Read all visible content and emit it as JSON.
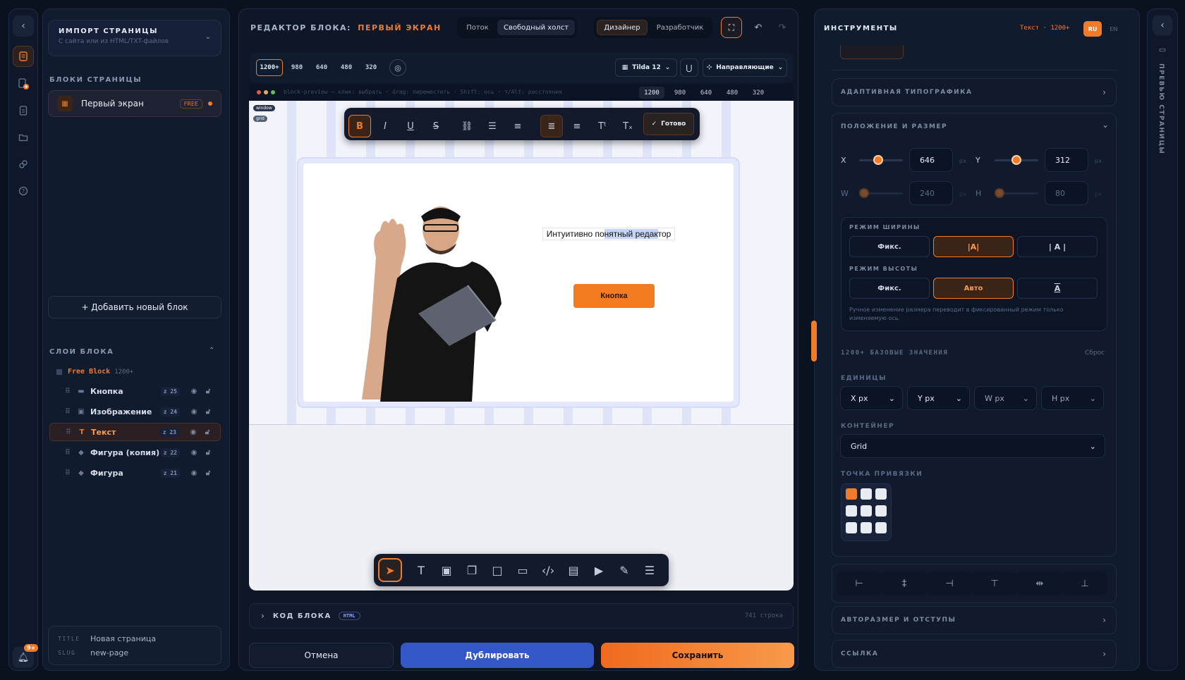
{
  "app": {
    "accent": "#f07b2b",
    "bg": "#0a1220"
  },
  "left": {
    "import_title": "ИМПОРТ СТРАНИЦЫ",
    "import_sub": "С сайта или из HTML/TXT-файлов",
    "blocks_title": "БЛОКИ СТРАНИЦЫ",
    "block_name": "Первый экран",
    "block_badge": "FREE",
    "add_block": "+ Добавить новый блок",
    "layers_title": "СЛОИ БЛОКА",
    "layer_root": "Free Block",
    "layer_root_bp": "1200+",
    "layers": [
      {
        "name": "Кнопка",
        "z": "z 25",
        "icon": "button-icon"
      },
      {
        "name": "Изображение",
        "z": "z 24",
        "icon": "image-icon"
      },
      {
        "name": "Текст",
        "z": "z 23",
        "icon": "text-icon"
      },
      {
        "name": "Фигура (копия)",
        "z": "z 22",
        "icon": "shape-icon"
      },
      {
        "name": "Фигура",
        "z": "z 21",
        "icon": "shape-icon"
      }
    ],
    "page_title_label": "TITLE",
    "page_title": "Новая страница",
    "slug_label": "SLUG",
    "slug": "new-page",
    "notif_count": "9+"
  },
  "editor": {
    "title_prefix": "РЕДАКТОР БЛОКА:",
    "title_block": "ПЕРВЫЙ ЭКРАН",
    "mode_tabs": [
      "Поток",
      "Свободный холст"
    ],
    "role_tabs": [
      "Дизайнер",
      "Разработчик"
    ],
    "breakpoints": [
      "1200+",
      "980",
      "640",
      "480",
      "320"
    ],
    "grid_label": "Tilda 12",
    "guides_label": "Направляющие",
    "preview_hint": "block-preview — клик: выбрать · drag: переместить · Shift: ось · ⌥/Alt: расстояния",
    "preview_bps": [
      "1200",
      "980",
      "640",
      "480",
      "320"
    ],
    "tag_window": "window",
    "tag_grid": "grid",
    "done_label": "Готово",
    "canvas_text_pre": "Интуитивно по",
    "canvas_text_sel": "нятный редак",
    "canvas_text_post": "тор",
    "canvas_button": "Кнопка",
    "code_title": "КОД БЛОКА",
    "code_badge": "HTML",
    "code_lines": "741 строка",
    "cancel": "Отмена",
    "duplicate": "Дублировать",
    "save": "Сохранить"
  },
  "tools": {
    "title": "ИНСТРУМЕНТЫ",
    "context": "Текст · 1200+",
    "lang_ru": "RU",
    "lang_en": "EN",
    "sec_typo": "АДАПТИВНАЯ ТИПОГРАФИКА",
    "sec_pos": "ПОЛОЖЕНИЕ И РАЗМЕР",
    "x_label": "X",
    "x_val": "646",
    "y_label": "Y",
    "y_val": "312",
    "w_label": "W",
    "w_val": "240",
    "h_label": "H",
    "h_val": "80",
    "unit": "px",
    "width_mode": "РЕЖИМ ШИРИНЫ",
    "width_opts": [
      "Фикс.",
      "|A|",
      "| A |"
    ],
    "height_mode": "РЕЖИМ ВЫСОТЫ",
    "height_opts": [
      "Фикс.",
      "Авто",
      "A"
    ],
    "mode_hint": "Ручное изменение размера переводит в фиксированный режим только изменяемую ось.",
    "base_title": "1200+ БАЗОВЫЕ ЗНАЧЕНИЯ",
    "reset": "Сброс",
    "units_title": "ЕДИНИЦЫ",
    "units": [
      "X px",
      "Y px",
      "W px",
      "H px"
    ],
    "container_title": "КОНТЕЙНЕР",
    "container_val": "Grid",
    "anchor_title": "ТОЧКА ПРИВЯЗКИ",
    "sec_autosize": "АВТОРАЗМЕР И ОТСТУПЫ",
    "sec_link": "ССЫЛКА"
  },
  "preview_rail": {
    "label": "ПРЕВЬЮ СТРАНИЦЫ"
  }
}
